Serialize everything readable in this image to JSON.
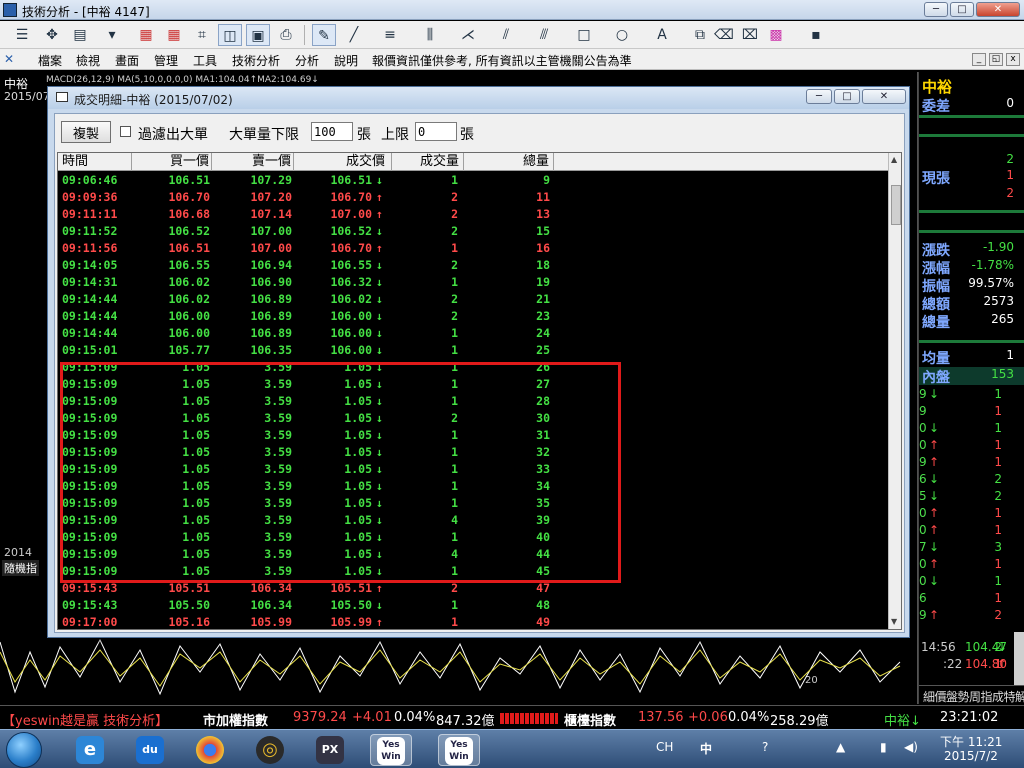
{
  "app": {
    "title": "技術分析 - [中裕 4147]",
    "win_min": "─",
    "win_max": "□",
    "win_close": "✕"
  },
  "menu": {
    "items": [
      "檔案",
      "檢視",
      "畫面",
      "管理",
      "工具",
      "技術分析",
      "分析",
      "說明",
      "報價資訊僅供參考, 所有資訊以主管機關公告為準"
    ]
  },
  "chart": {
    "stock_name": "中裕",
    "date": "2015/07",
    "indicator_text": "MACD(26,12,9) MA(5,10,0,0,0,0) MA1:104.04↑MA2:104.69↓",
    "year_label": "2014",
    "indicator_label": "隨機指",
    "y_label": "20"
  },
  "right_panel": {
    "stock_name": "中裕",
    "weicha_label": "委差",
    "weicha_value": "0",
    "top_vals": [
      "2",
      "1",
      "2"
    ],
    "xianzhang_label": "現張",
    "stats": [
      {
        "label": "漲跌",
        "value": "-1.90",
        "color": "#44e044"
      },
      {
        "label": "漲幅",
        "value": "-1.78%",
        "color": "#44e044"
      },
      {
        "label": "振幅",
        "value": "99.57%",
        "color": "#ffffff"
      },
      {
        "label": "總額",
        "value": "2573",
        "color": "#ffffff"
      },
      {
        "label": "總量",
        "value": "265",
        "color": "#ffffff"
      }
    ],
    "junliang_label": "均量",
    "junliang_value": "1",
    "neipan_label": "內盤",
    "neipan_value": "153",
    "ticks": [
      {
        "t": "9",
        "dir": "dn",
        "v": "1"
      },
      {
        "t": "9",
        "dir": "",
        "v": "1"
      },
      {
        "t": "0",
        "dir": "dn",
        "v": "1"
      },
      {
        "t": "0",
        "dir": "up",
        "v": "1"
      },
      {
        "t": "9",
        "dir": "up",
        "v": "1"
      },
      {
        "t": "6",
        "dir": "dn",
        "v": "2"
      },
      {
        "t": "5",
        "dir": "dn",
        "v": "2"
      },
      {
        "t": "0",
        "dir": "up",
        "v": "1"
      },
      {
        "t": "0",
        "dir": "up",
        "v": "1"
      },
      {
        "t": "7",
        "dir": "dn",
        "v": "3"
      },
      {
        "t": "0",
        "dir": "up",
        "v": "1"
      },
      {
        "t": "0",
        "dir": "dn",
        "v": "1"
      },
      {
        "t": "6",
        "dir": "",
        "v": "1"
      },
      {
        "t": "9",
        "dir": "up",
        "v": "2"
      }
    ],
    "last_rows": [
      {
        "time": "14:56",
        "price": "104.47",
        "dir": "dn",
        "vol": "2"
      },
      {
        "time": ":22",
        "price": "104.80",
        "dir": "up",
        "vol": "1"
      }
    ],
    "tabs": [
      "細",
      "價",
      "盤",
      "勢",
      "周",
      "指",
      "成",
      "特",
      "解"
    ]
  },
  "dialog": {
    "title": "成交明細-中裕 (2015/07/02)",
    "copy_label": "複製",
    "filter_label": "過濾出大單",
    "lower_label": "大單量下限",
    "lower_value": "100",
    "unit1": "張",
    "upper_label": "上限",
    "upper_value": "0",
    "unit2": "張"
  },
  "table": {
    "columns": [
      "時間",
      "買一價",
      "賣一價",
      "成交價",
      "成交量",
      "總量"
    ],
    "rows": [
      {
        "time": "09:06:46",
        "bid": "106.51",
        "ask": "107.29",
        "price": "106.51",
        "dir": "dn",
        "vol": "1",
        "total": "9"
      },
      {
        "time": "09:09:36",
        "bid": "106.70",
        "ask": "107.20",
        "price": "106.70",
        "dir": "up",
        "vol": "2",
        "total": "11"
      },
      {
        "time": "09:11:11",
        "bid": "106.68",
        "ask": "107.14",
        "price": "107.00",
        "dir": "up",
        "vol": "2",
        "total": "13"
      },
      {
        "time": "09:11:52",
        "bid": "106.52",
        "ask": "107.00",
        "price": "106.52",
        "dir": "dn",
        "vol": "2",
        "total": "15"
      },
      {
        "time": "09:11:56",
        "bid": "106.51",
        "ask": "107.00",
        "price": "106.70",
        "dir": "up",
        "vol": "1",
        "total": "16"
      },
      {
        "time": "09:14:05",
        "bid": "106.55",
        "ask": "106.94",
        "price": "106.55",
        "dir": "dn",
        "vol": "2",
        "total": "18"
      },
      {
        "time": "09:14:31",
        "bid": "106.02",
        "ask": "106.90",
        "price": "106.32",
        "dir": "dn",
        "vol": "1",
        "total": "19"
      },
      {
        "time": "09:14:44",
        "bid": "106.02",
        "ask": "106.89",
        "price": "106.02",
        "dir": "dn",
        "vol": "2",
        "total": "21"
      },
      {
        "time": "09:14:44",
        "bid": "106.00",
        "ask": "106.89",
        "price": "106.00",
        "dir": "dn",
        "vol": "2",
        "total": "23"
      },
      {
        "time": "09:14:44",
        "bid": "106.00",
        "ask": "106.89",
        "price": "106.00",
        "dir": "dn",
        "vol": "1",
        "total": "24"
      },
      {
        "time": "09:15:01",
        "bid": "105.77",
        "ask": "106.35",
        "price": "106.00",
        "dir": "dn",
        "vol": "1",
        "total": "25"
      },
      {
        "time": "09:15:09",
        "bid": "1.05",
        "ask": "3.59",
        "price": "1.05",
        "dir": "dn",
        "vol": "1",
        "total": "26"
      },
      {
        "time": "09:15:09",
        "bid": "1.05",
        "ask": "3.59",
        "price": "1.05",
        "dir": "dn",
        "vol": "1",
        "total": "27"
      },
      {
        "time": "09:15:09",
        "bid": "1.05",
        "ask": "3.59",
        "price": "1.05",
        "dir": "dn",
        "vol": "1",
        "total": "28"
      },
      {
        "time": "09:15:09",
        "bid": "1.05",
        "ask": "3.59",
        "price": "1.05",
        "dir": "dn",
        "vol": "2",
        "total": "30"
      },
      {
        "time": "09:15:09",
        "bid": "1.05",
        "ask": "3.59",
        "price": "1.05",
        "dir": "dn",
        "vol": "1",
        "total": "31"
      },
      {
        "time": "09:15:09",
        "bid": "1.05",
        "ask": "3.59",
        "price": "1.05",
        "dir": "dn",
        "vol": "1",
        "total": "32"
      },
      {
        "time": "09:15:09",
        "bid": "1.05",
        "ask": "3.59",
        "price": "1.05",
        "dir": "dn",
        "vol": "1",
        "total": "33"
      },
      {
        "time": "09:15:09",
        "bid": "1.05",
        "ask": "3.59",
        "price": "1.05",
        "dir": "dn",
        "vol": "1",
        "total": "34"
      },
      {
        "time": "09:15:09",
        "bid": "1.05",
        "ask": "3.59",
        "price": "1.05",
        "dir": "dn",
        "vol": "1",
        "total": "35"
      },
      {
        "time": "09:15:09",
        "bid": "1.05",
        "ask": "3.59",
        "price": "1.05",
        "dir": "dn",
        "vol": "4",
        "total": "39"
      },
      {
        "time": "09:15:09",
        "bid": "1.05",
        "ask": "3.59",
        "price": "1.05",
        "dir": "dn",
        "vol": "1",
        "total": "40"
      },
      {
        "time": "09:15:09",
        "bid": "1.05",
        "ask": "3.59",
        "price": "1.05",
        "dir": "dn",
        "vol": "4",
        "total": "44"
      },
      {
        "time": "09:15:09",
        "bid": "1.05",
        "ask": "3.59",
        "price": "1.05",
        "dir": "dn",
        "vol": "1",
        "total": "45"
      },
      {
        "time": "09:15:43",
        "bid": "105.51",
        "ask": "106.34",
        "price": "105.51",
        "dir": "up",
        "vol": "2",
        "total": "47"
      },
      {
        "time": "09:15:43",
        "bid": "105.50",
        "ask": "106.34",
        "price": "105.50",
        "dir": "dn",
        "vol": "1",
        "total": "48"
      },
      {
        "time": "09:17:00",
        "bid": "105.16",
        "ask": "105.99",
        "price": "105.99",
        "dir": "up",
        "vol": "1",
        "total": "49"
      }
    ]
  },
  "ticker": {
    "brand": "【yeswin越是贏 技術分析】",
    "idx1_name": "市加權指數",
    "idx1_val": "9379.24",
    "idx1_chg": "+4.01",
    "idx1_pct": "0.04%",
    "idx1_amt": "847.32億",
    "idx2_name": "櫃檯指數",
    "idx2_val": "137.56",
    "idx2_chg": "+0.06",
    "idx2_pct": "0.04%",
    "idx2_amt": "258.29億",
    "stock": "中裕↓",
    "time": "23:21:02"
  },
  "taskbar": {
    "apps": [
      "e",
      "du",
      "●",
      "◎",
      "PX",
      "Yes Win",
      "Yes Win"
    ],
    "ime": "CH",
    "ime_zh": "中",
    "clock_time": "下午 11:21",
    "clock_date": "2015/7/2"
  },
  "colors": {
    "up": "#ff4a4a",
    "down": "#44e044",
    "highlight": "#e01a1a"
  }
}
